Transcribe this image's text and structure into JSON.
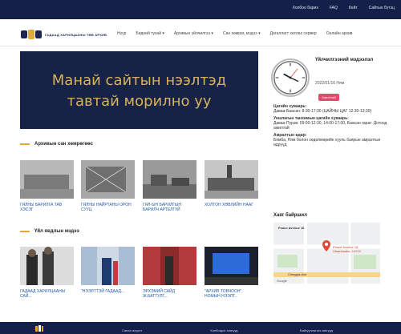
{
  "topbar": {
    "links": [
      "Холбоо барих",
      "FAQ",
      "Кейт",
      "Сайтын бүтэц"
    ]
  },
  "brand": {
    "name": "ГАДААД ХАРИЛЦААНЫ ТӨВ АРХИВ"
  },
  "nav": {
    "items": [
      "Нүүр",
      "Бидний тухай ▾",
      "Архивын үйлчилгээ ▾",
      "Сан хөмрөг, мэдээ ▾",
      "Дагаллагт хөтлөх сервер",
      "Онлайн архив"
    ]
  },
  "hero": {
    "line1": "Манай сайтын нээлтэд",
    "line2": "тавтай морилно уу"
  },
  "archive": {
    "heading": "Архивын сан хөмрөгөөс",
    "items": [
      "ГЯЛНЫ БАРИЛГА ТАВ ХЭСЭГ",
      "ГЯЛНЫ НАЙРТАНЫ ОРОН СУУЦ",
      "ГЯЛ-ын барилгын барилч артелгүй",
      "Холтон хөвлийн нааг"
    ]
  },
  "news": {
    "heading": "Үйл явдлын мэдээ",
    "items": [
      "ГАДААД ХАРИЛЦААНЫ САЙ...",
      "\"НЭЭЛТТЭЙ ГАДААД...",
      "ЭРХЭМИЙ САЙД Ж.БАТТУЛГ...",
      "\"АРХИВ ТОВЧООН\" НОМЫН НЭЭЛТ..."
    ]
  },
  "sidebar": {
    "title": "Үйлчилгээний мэдээлэл",
    "date": "2022/01/16 Ням",
    "status": "Хаалттай",
    "schedule": [
      {
        "label": "Цагийн хуваарь:",
        "text": "Даваа-Баасан: 8:30-17:30 (ЦАЙНЫ ЦАГ 12:30-13:30)"
      },
      {
        "label": "Уншлагын танхимын цагийн хуваарь:",
        "text": "Даваа-Пүрэв: 09:00-12:30, 14:00-17:00, Баасан гараг: Дотоод ажилтай"
      },
      {
        "label": "Амралтын өдөр:",
        "text": "Бямба, Ням болон хөдөлмөрийн хууль баярын амралтын өдрүүд"
      }
    ]
  },
  "map": {
    "heading": "Хаяг байршил",
    "place": "Peace Avenue 16",
    "label2": "Peace Avenue 16, Ulaanbaatar, 14210",
    "label3": "Chinggis Ave",
    "google": "Google"
  },
  "footer": {
    "links": [
      "Санал асуулт",
      "Холбогдох хаягууд",
      "Байгууллагын хаягууд"
    ]
  },
  "colors": {
    "navy": "#14204a",
    "gold": "#d8b25a",
    "accent": "#e3a83a",
    "link": "#1e5aa8",
    "badge": "#e14b6a"
  }
}
